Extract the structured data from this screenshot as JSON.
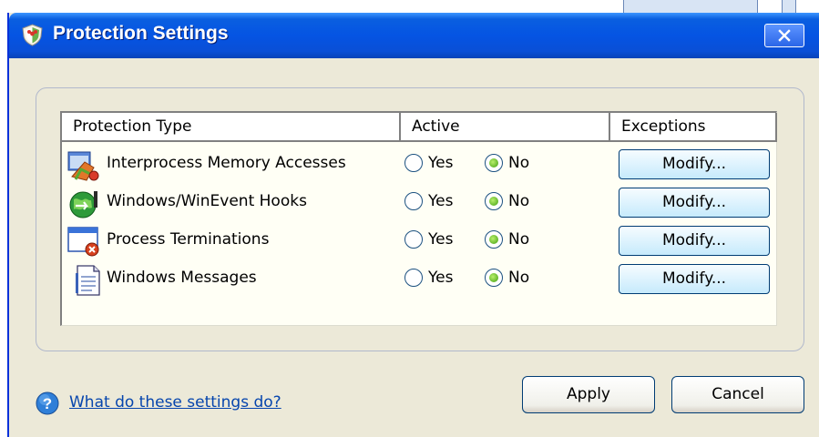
{
  "window": {
    "title": "Protection Settings"
  },
  "table": {
    "headers": [
      "Protection Type",
      "Active",
      "Exceptions"
    ],
    "rows": [
      {
        "label": "Interprocess Memory Accesses",
        "icon": "memory-access-icon",
        "yes": "Yes",
        "no": "No",
        "selected": "No",
        "button": "Modify..."
      },
      {
        "label": "Windows/WinEvent Hooks",
        "icon": "globe-hooks-icon",
        "yes": "Yes",
        "no": "No",
        "selected": "No",
        "button": "Modify..."
      },
      {
        "label": "Process Terminations",
        "icon": "process-termination-icon",
        "yes": "Yes",
        "no": "No",
        "selected": "No",
        "button": "Modify..."
      },
      {
        "label": "Windows Messages",
        "icon": "document-icon",
        "yes": "Yes",
        "no": "No",
        "selected": "No",
        "button": "Modify..."
      }
    ]
  },
  "footer": {
    "help_link": "What do these settings do?",
    "apply": "Apply",
    "cancel": "Cancel"
  },
  "colors": {
    "titlebar": "#0554e3",
    "face": "#ece9d8",
    "link": "#0645ad",
    "radio_on": "#3f9d10"
  }
}
